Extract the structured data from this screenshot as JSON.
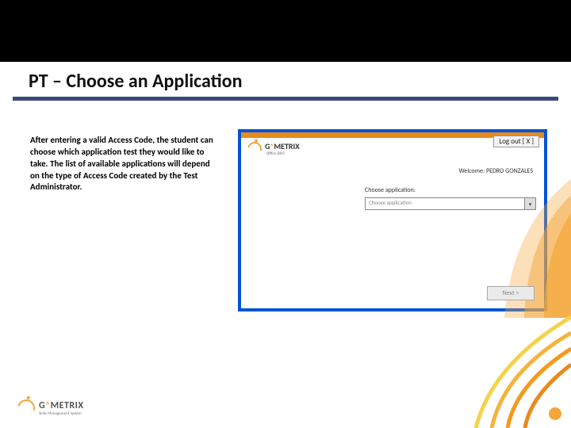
{
  "slide": {
    "title": "PT – Choose an Application",
    "body": "After entering a valid Access Code, the student can choose which application test they would like to take. The list of available applications will depend on the type of Access Code created by the Test Administrator."
  },
  "app": {
    "logout": "Log out [ X ]",
    "logo_text": "G METRIX",
    "logo_sub": "Office 2007",
    "welcome": "Welcome: PEDRO GONZALES",
    "choose_label": "Choose application:",
    "dropdown_placeholder": "Choose application",
    "next": "Next >"
  },
  "footer": {
    "brand": "G METRIX",
    "tagline": "Skills Management System"
  }
}
